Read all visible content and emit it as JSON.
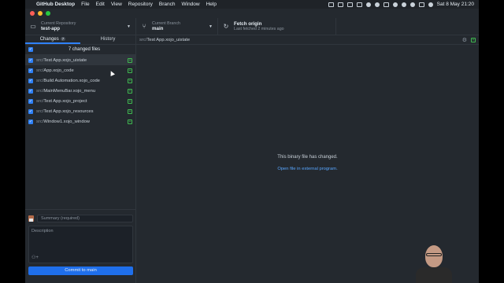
{
  "menubar": {
    "app_name": "GitHub Desktop",
    "menus": [
      "File",
      "Edit",
      "View",
      "Repository",
      "Branch",
      "Window",
      "Help"
    ],
    "datetime": "Sat 8 May  21:20"
  },
  "toolbar": {
    "repo_label": "Current Repository",
    "repo_value": "test-app",
    "branch_label": "Current Branch",
    "branch_value": "main",
    "fetch_label": "Fetch origin",
    "fetch_sub": "Last fetched 2 minutes ago"
  },
  "tabs": {
    "changes": "Changes",
    "changes_count": "7",
    "history": "History"
  },
  "changes": {
    "header": "7 changed files",
    "files": [
      {
        "dir": "src/",
        "name": "Test App.xojo_uistate"
      },
      {
        "dir": "src/",
        "name": "App.xojo_code"
      },
      {
        "dir": "src/",
        "name": "Build Automation.xojo_code"
      },
      {
        "dir": "src/",
        "name": "MainMenuBar.xojo_menu"
      },
      {
        "dir": "src/",
        "name": "Test App.xojo_project"
      },
      {
        "dir": "src/",
        "name": "Test App.xojo_resources"
      },
      {
        "dir": "src/",
        "name": "Window1.xojo_window"
      }
    ]
  },
  "commit": {
    "summary_placeholder": "Summary (required)",
    "description_placeholder": "Description",
    "button": "Commit to main"
  },
  "diff": {
    "path_dir": "src/",
    "path_file": "Test App.xojo_uistate",
    "message": "This binary file has changed.",
    "link": "Open file in external program."
  },
  "colors": {
    "accent": "#2f81f7",
    "added": "#3fb950",
    "link": "#58a6ff"
  }
}
